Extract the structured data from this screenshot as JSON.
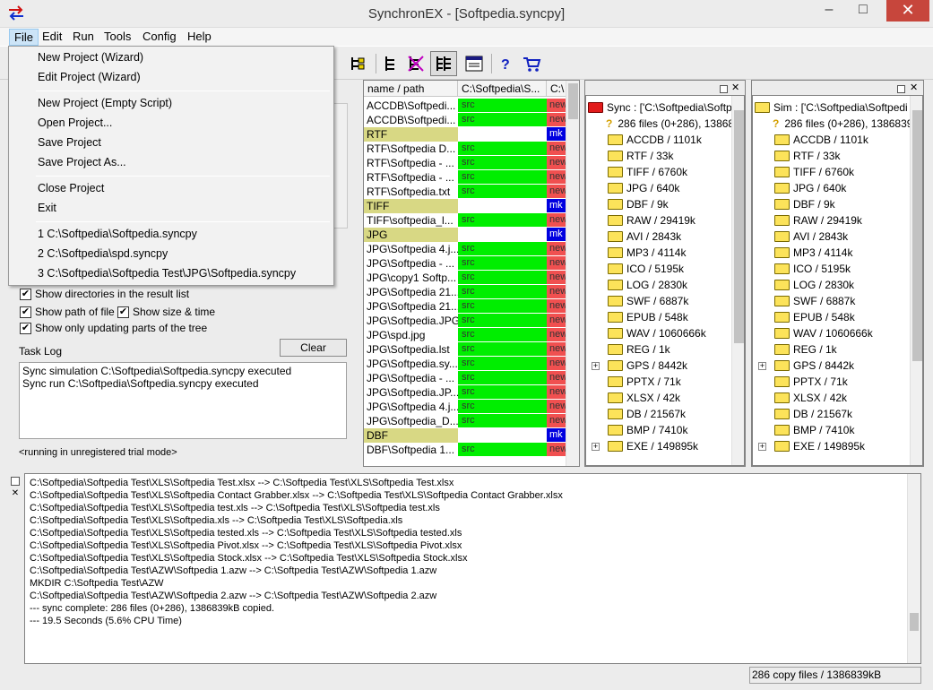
{
  "window": {
    "title": "SynchronEX - [Softpedia.syncpy]",
    "minimize": "–",
    "maximize": "□",
    "close": "✕"
  },
  "menubar": [
    "File",
    "Edit",
    "Run",
    "Tools",
    "Config",
    "Help"
  ],
  "file_menu": {
    "items": [
      "New Project (Wizard)",
      "Edit Project (Wizard)",
      "New Project (Empty Script)",
      "Open Project...",
      "Save Project",
      "Save Project As...",
      "Close Project",
      "Exit",
      "1 C:\\Softpedia\\Softpedia.syncpy",
      "2 C:\\Softpedia\\spd.syncpy",
      "3 C:\\Softpedia\\Softpedia Test\\JPG\\Softpedia.syncpy"
    ]
  },
  "options": {
    "show_dirs": "Show directories in the result list",
    "show_path": "Show path of file",
    "show_size": "Show size & time",
    "show_updating": "Show only updating parts of the tree"
  },
  "task_log": {
    "label": "Task Log",
    "clear_label": "Clear",
    "lines": [
      "Sync simulation C:\\Softpedia\\Softpedia.syncpy executed",
      "Sync run C:\\Softpedia\\Softpedia.syncpy executed"
    ],
    "trial_note": "<running in unregistered trial mode>"
  },
  "result_list": {
    "headers": [
      "name / path",
      "C:\\Softpedia\\S...",
      "C:\\"
    ],
    "rows": [
      {
        "name": "ACCDB\\Softpedi...",
        "src": "src",
        "dst": "new",
        "folder": false
      },
      {
        "name": "ACCDB\\Softpedi...",
        "src": "src",
        "dst": "new",
        "folder": false
      },
      {
        "name": "RTF",
        "src": "",
        "dst": "mk",
        "folder": true
      },
      {
        "name": "RTF\\Softpedia D...",
        "src": "src",
        "dst": "new",
        "folder": false
      },
      {
        "name": "RTF\\Softpedia - ...",
        "src": "src",
        "dst": "new",
        "folder": false
      },
      {
        "name": "RTF\\Softpedia - ...",
        "src": "src",
        "dst": "new",
        "folder": false
      },
      {
        "name": "RTF\\Softpedia.txt",
        "src": "src",
        "dst": "new",
        "folder": false
      },
      {
        "name": "TIFF",
        "src": "",
        "dst": "mk",
        "folder": true
      },
      {
        "name": "TIFF\\softpedia_l...",
        "src": "src",
        "dst": "new",
        "folder": false
      },
      {
        "name": "JPG",
        "src": "",
        "dst": "mk",
        "folder": true
      },
      {
        "name": "JPG\\Softpedia 4.j...",
        "src": "src",
        "dst": "new",
        "folder": false
      },
      {
        "name": "JPG\\Softpedia - ...",
        "src": "src",
        "dst": "new",
        "folder": false
      },
      {
        "name": "JPG\\copy1 Softp...",
        "src": "src",
        "dst": "new",
        "folder": false
      },
      {
        "name": "JPG\\Softpedia 21...",
        "src": "src",
        "dst": "new",
        "folder": false
      },
      {
        "name": "JPG\\Softpedia 21...",
        "src": "src",
        "dst": "new",
        "folder": false
      },
      {
        "name": "JPG\\Softpedia.JPG",
        "src": "src",
        "dst": "new",
        "folder": false
      },
      {
        "name": "JPG\\spd.jpg",
        "src": "src",
        "dst": "new",
        "folder": false
      },
      {
        "name": "JPG\\Softpedia.lst",
        "src": "src",
        "dst": "new",
        "folder": false
      },
      {
        "name": "JPG\\Softpedia.sy...",
        "src": "src",
        "dst": "new",
        "folder": false
      },
      {
        "name": "JPG\\Softpedia - ...",
        "src": "src",
        "dst": "new",
        "folder": false
      },
      {
        "name": "JPG\\Softpedia.JP...",
        "src": "src",
        "dst": "new",
        "folder": false
      },
      {
        "name": "JPG\\Softpedia 4.j...",
        "src": "src",
        "dst": "new",
        "folder": false
      },
      {
        "name": "JPG\\Softpedia_D...",
        "src": "src",
        "dst": "new",
        "folder": false
      },
      {
        "name": "DBF",
        "src": "",
        "dst": "mk",
        "folder": true
      },
      {
        "name": "DBF\\Softpedia 1...",
        "src": "src",
        "dst": "new",
        "folder": false
      }
    ]
  },
  "sync_tree": {
    "root": "Sync : ['C:\\Softpedia\\Softp",
    "summary": "286 files (0+286), 13868"
  },
  "sim_tree": {
    "root": "Sim : ['C:\\Softpedia\\Softpedi",
    "summary": "286 files (0+286), 1386839"
  },
  "tree_items": [
    {
      "label": "ACCDB / 1101k",
      "expandable": false
    },
    {
      "label": "RTF / 33k",
      "expandable": false
    },
    {
      "label": "TIFF / 6760k",
      "expandable": false
    },
    {
      "label": "JPG / 640k",
      "expandable": false
    },
    {
      "label": "DBF / 9k",
      "expandable": false
    },
    {
      "label": "RAW / 29419k",
      "expandable": false
    },
    {
      "label": "AVI / 2843k",
      "expandable": false
    },
    {
      "label": "MP3 / 4114k",
      "expandable": false
    },
    {
      "label": "ICO / 5195k",
      "expandable": false
    },
    {
      "label": "LOG / 2830k",
      "expandable": false
    },
    {
      "label": "SWF / 6887k",
      "expandable": false
    },
    {
      "label": "EPUB / 548k",
      "expandable": false
    },
    {
      "label": "WAV / 1060666k",
      "expandable": false
    },
    {
      "label": "REG / 1k",
      "expandable": false
    },
    {
      "label": "GPS / 8442k",
      "expandable": true
    },
    {
      "label": "PPTX / 71k",
      "expandable": false
    },
    {
      "label": "XLSX / 42k",
      "expandable": false
    },
    {
      "label": "DB / 21567k",
      "expandable": false
    },
    {
      "label": "BMP / 7410k",
      "expandable": false
    },
    {
      "label": "EXE / 149895k",
      "expandable": true
    }
  ],
  "console_lines": [
    "C:\\Softpedia\\Softpedia Test\\XLS\\Softpedia Test.xlsx --> C:\\Softpedia Test\\XLS\\Softpedia Test.xlsx",
    "C:\\Softpedia\\Softpedia Test\\XLS\\Softpedia Contact Grabber.xlsx --> C:\\Softpedia Test\\XLS\\Softpedia Contact Grabber.xlsx",
    "C:\\Softpedia\\Softpedia Test\\XLS\\Softpedia test.xls --> C:\\Softpedia Test\\XLS\\Softpedia test.xls",
    "C:\\Softpedia\\Softpedia Test\\XLS\\Softpedia.xls --> C:\\Softpedia Test\\XLS\\Softpedia.xls",
    "C:\\Softpedia\\Softpedia Test\\XLS\\Softpedia tested.xls --> C:\\Softpedia Test\\XLS\\Softpedia tested.xls",
    "C:\\Softpedia\\Softpedia Test\\XLS\\Softpedia Pivot.xlsx --> C:\\Softpedia Test\\XLS\\Softpedia Pivot.xlsx",
    "C:\\Softpedia\\Softpedia Test\\XLS\\Softpedia Stock.xlsx --> C:\\Softpedia Test\\XLS\\Softpedia Stock.xlsx",
    "C:\\Softpedia\\Softpedia Test\\AZW\\Softpedia 1.azw --> C:\\Softpedia Test\\AZW\\Softpedia 1.azw",
    "MKDIR C:\\Softpedia Test\\AZW",
    "C:\\Softpedia\\Softpedia Test\\AZW\\Softpedia 2.azw --> C:\\Softpedia Test\\AZW\\Softpedia 2.azw",
    "--- sync complete: 286 files (0+286), 1386839kB copied.",
    "--- 19.5 Seconds (5.6% CPU Time)"
  ],
  "status": {
    "copy_count": "286 copy files / 1386839kB"
  },
  "colors": {
    "src_green": "#00ee00",
    "new_red": "#f05050",
    "folder_yellow": "#d8d884",
    "mk_blue": "#0000e0",
    "close_red": "#c7463c"
  }
}
